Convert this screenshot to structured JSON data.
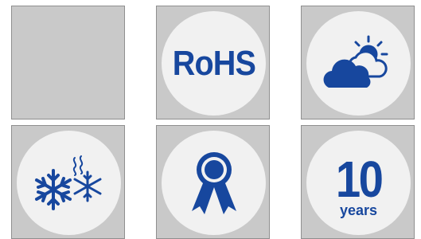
{
  "tiles": {
    "rohs": {
      "label": "RoHS"
    },
    "warranty": {
      "number": "10",
      "unit": "years"
    }
  },
  "colors": {
    "icon_blue": "#17479e",
    "tile_gray": "#c9c9c9",
    "disc_fill": "#f1f1f1"
  },
  "icons": [
    "empty",
    "rohs",
    "weather-sun-cloud-icon",
    "snowflake-frost-icon",
    "award-ribbon-icon",
    "ten-years-warranty"
  ]
}
